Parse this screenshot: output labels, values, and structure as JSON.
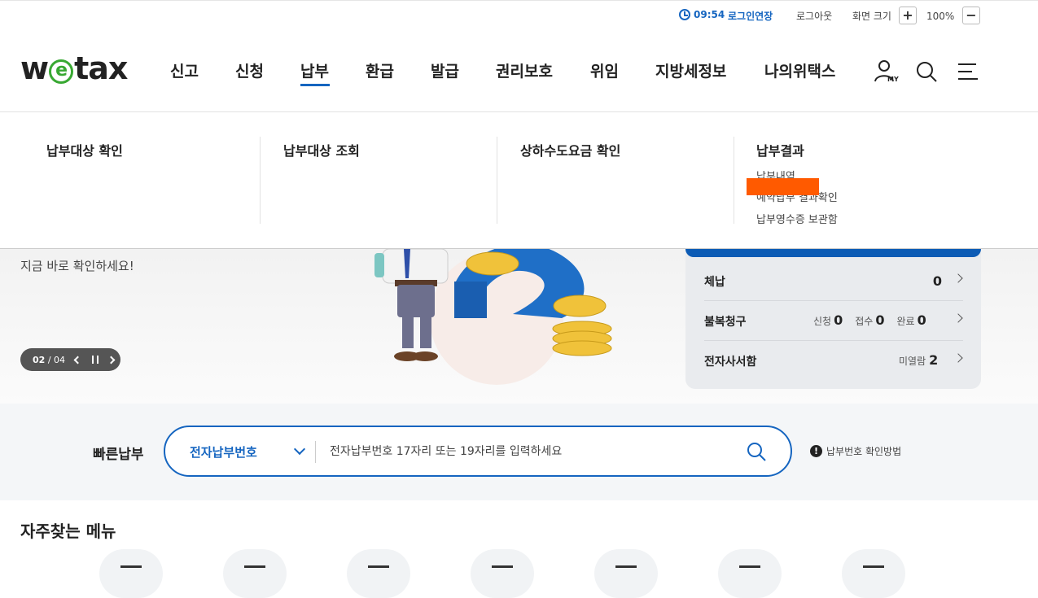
{
  "util": {
    "time": "09:54",
    "extend_login": "로그인연장",
    "logout": "로그아웃",
    "zoom_label": "화면 크기",
    "zoom_in": "+",
    "zoom_value": "100%",
    "zoom_out": "−"
  },
  "header": {
    "logo": "wetax",
    "nav": [
      "신고",
      "신청",
      "납부",
      "환급",
      "발급",
      "권리보호",
      "위임",
      "지방세정보",
      "나의위택스"
    ],
    "active_nav": "납부",
    "my_label": "MY"
  },
  "dropdown": {
    "columns": [
      {
        "title": "납부대상 확인",
        "items": []
      },
      {
        "title": "납부대상 조회",
        "items": []
      },
      {
        "title": "상하수도요금 확인",
        "items": []
      },
      {
        "title": "납부결과",
        "items": [
          "납부내역",
          "예약납부 결과확인",
          "납부영수증 보관함"
        ]
      }
    ]
  },
  "hero": {
    "text": "지금 바로 확인하세요!",
    "slide_current": "02",
    "slide_sep": "/",
    "slide_total": "04"
  },
  "panel": {
    "overdue": {
      "label": "체납",
      "count": "0"
    },
    "appeal": {
      "label": "불복청구",
      "apply_label": "신청",
      "apply": "0",
      "receipt_label": "접수",
      "receipt": "0",
      "done_label": "완료",
      "done": "0"
    },
    "mailbox": {
      "label": "전자사서함",
      "unread_label": "미열람",
      "unread": "2"
    }
  },
  "quickpay": {
    "label": "빠른납부",
    "select": "전자납부번호",
    "placeholder": "전자납부번호 17자리 또는 19자리를 입력하세요",
    "help": "납부번호 확인방법"
  },
  "favorites": {
    "title": "자주찾는 메뉴"
  },
  "colors": {
    "brand_blue": "#1565c0",
    "logo_green": "#38a832",
    "redaction": "#ff5a00"
  }
}
